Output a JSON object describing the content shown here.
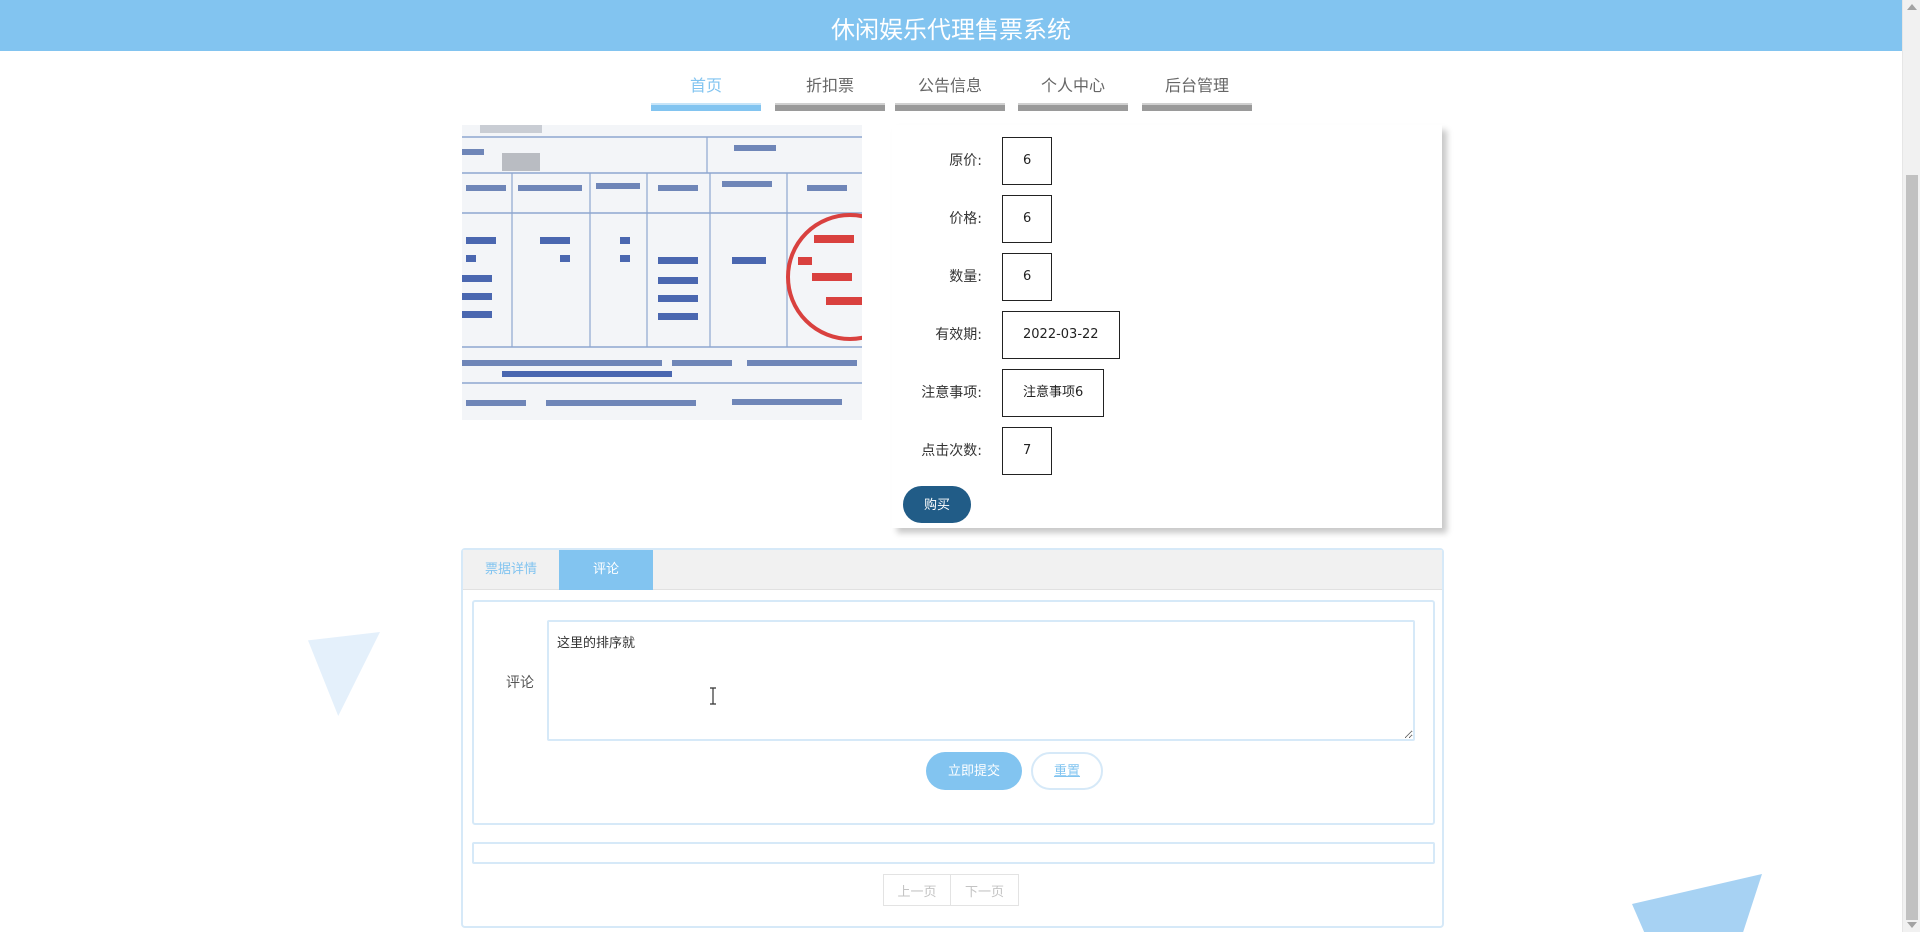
{
  "header": {
    "title": "休闲娱乐代理售票系统"
  },
  "nav": {
    "items": [
      {
        "label": "首页",
        "active": true
      },
      {
        "label": "折扣票",
        "active": false
      },
      {
        "label": "公告信息",
        "active": false
      },
      {
        "label": "个人中心",
        "active": false
      },
      {
        "label": "后台管理",
        "active": false
      }
    ]
  },
  "ticket": {
    "fields": [
      {
        "label": "原价:",
        "value": "6"
      },
      {
        "label": "价格:",
        "value": "6"
      },
      {
        "label": "数量:",
        "value": "6"
      },
      {
        "label": "有效期:",
        "value": "2022-03-22"
      },
      {
        "label": "注意事项:",
        "value": "注意事项6"
      },
      {
        "label": "点击次数:",
        "value": "7"
      }
    ],
    "buy_label": "购买"
  },
  "tabs": [
    {
      "label": "票据详情",
      "active": false
    },
    {
      "label": "评论",
      "active": true
    }
  ],
  "comment": {
    "label": "评论",
    "value": "这里的排序就",
    "submit_label": "立即提交",
    "reset_label": "重置"
  },
  "pager": {
    "prev_label": "上一页",
    "next_label": "下一页"
  },
  "colors": {
    "accent": "#82c4f0",
    "buy_button": "#215c87"
  }
}
